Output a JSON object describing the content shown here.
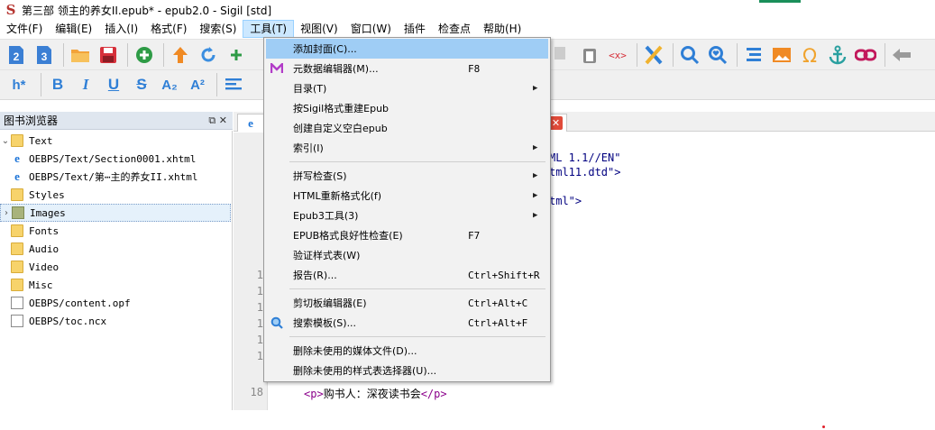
{
  "window": {
    "app_icon_glyph": "S",
    "title": "第三部 领主的养女II.epub* - epub2.0 - Sigil [std]"
  },
  "menubar": [
    {
      "label": "文件(F)"
    },
    {
      "label": "编辑(E)"
    },
    {
      "label": "插入(I)"
    },
    {
      "label": "格式(F)"
    },
    {
      "label": "搜索(S)"
    },
    {
      "label": "工具(T)"
    },
    {
      "label": "视图(V)"
    },
    {
      "label": "窗口(W)"
    },
    {
      "label": "插件"
    },
    {
      "label": "检查点"
    },
    {
      "label": "帮助(H)"
    }
  ],
  "toolbar2_text": {
    "heading": "h*",
    "bold": "B",
    "italic": "I",
    "underline": "U",
    "strike": "S",
    "subscript": "A₂",
    "superscript": "A²"
  },
  "book_browser": {
    "title": "图书浏览器",
    "items": [
      {
        "label": "Text",
        "type": "folder",
        "expanded": true
      },
      {
        "label": "OEBPS/Text/Section0001.xhtml",
        "type": "xhtml"
      },
      {
        "label": "OEBPS/Text/第⋯主的养女II.xhtml",
        "type": "xhtml"
      },
      {
        "label": "Styles",
        "type": "folder"
      },
      {
        "label": "Images",
        "type": "folder",
        "selected": true
      },
      {
        "label": "Fonts",
        "type": "folder"
      },
      {
        "label": "Audio",
        "type": "folder"
      },
      {
        "label": "Video",
        "type": "folder"
      },
      {
        "label": "Misc",
        "type": "folder"
      },
      {
        "label": "OEBPS/content.opf",
        "type": "file"
      },
      {
        "label": "OEBPS/toc.ncx",
        "type": "file"
      }
    ]
  },
  "editor": {
    "line_numbers": [
      "1",
      "1",
      "1",
      "1",
      "1",
      "1",
      "18"
    ],
    "code_fragments": [
      "ML 1.1//EN\"",
      "tml11.dtd\">",
      "tml\">"
    ],
    "last_line": {
      "open_tag": "<p>",
      "text": "购书人：深夜读书会",
      "close_tag": "</p>"
    }
  },
  "tools_menu": {
    "items": [
      {
        "label": "添加封面(C)...",
        "shortcut": "",
        "submenu": false,
        "highlighted": true
      },
      {
        "label": "元数据编辑器(M)...",
        "shortcut": "F8",
        "submenu": false,
        "icon": "metadata-icon"
      },
      {
        "label": "目录(T)",
        "shortcut": "",
        "submenu": true
      },
      {
        "label": "按Sigil格式重建Epub",
        "shortcut": "",
        "submenu": false
      },
      {
        "label": "创建自定义空白epub",
        "shortcut": "",
        "submenu": false
      },
      {
        "label": "索引(I)",
        "shortcut": "",
        "submenu": true
      },
      {
        "label": "拼写检查(S)",
        "shortcut": "",
        "submenu": true
      },
      {
        "label": "HTML重新格式化(f)",
        "shortcut": "",
        "submenu": true
      },
      {
        "label": "Epub3工具(3)",
        "shortcut": "",
        "submenu": true
      },
      {
        "label": "EPUB格式良好性检查(E)",
        "shortcut": "F7",
        "submenu": false
      },
      {
        "label": "验证样式表(W)",
        "shortcut": "",
        "submenu": false
      },
      {
        "label": "报告(R)...",
        "shortcut": "Ctrl+Shift+R",
        "submenu": false
      },
      {
        "label": "剪切板编辑器(E)",
        "shortcut": "Ctrl+Alt+C",
        "submenu": false
      },
      {
        "label": "搜索模板(S)...",
        "shortcut": "Ctrl+Alt+F",
        "submenu": false,
        "icon": "search-icon"
      },
      {
        "label": "删除未使用的媒体文件(D)...",
        "shortcut": "",
        "submenu": false
      },
      {
        "label": "删除未使用的样式表选择器(U)...",
        "shortcut": "",
        "submenu": false
      }
    ]
  },
  "colors": {
    "menu_highlight": "#9fcdf5",
    "active_menu": "#cce8ff",
    "tag_color": "#8b008b",
    "attr_color": "#000080"
  }
}
